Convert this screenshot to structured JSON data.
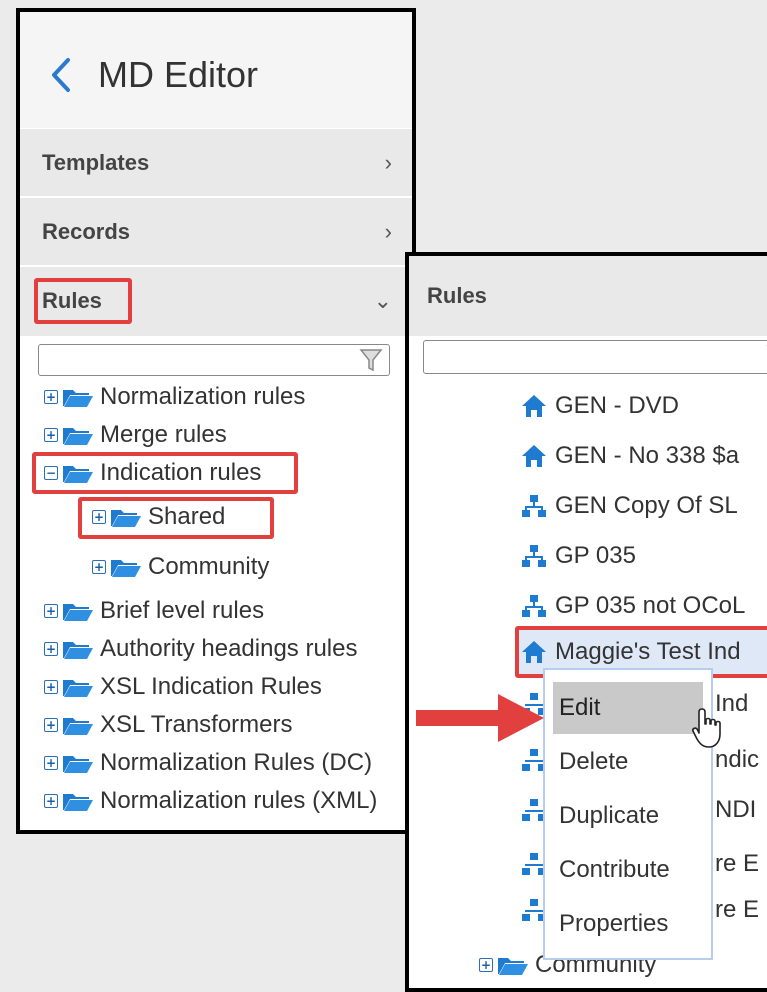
{
  "panel1": {
    "title": "MD Editor",
    "sections": [
      {
        "label": "Templates",
        "chevron": "›"
      },
      {
        "label": "Records",
        "chevron": "›"
      },
      {
        "label": "Rules",
        "chevron": "⌄"
      }
    ],
    "filter_icon": "funnel-icon",
    "tree": [
      {
        "label": "Normalization rules",
        "toggle": "+"
      },
      {
        "label": "Merge rules",
        "toggle": "+"
      },
      {
        "label": "Indication rules",
        "toggle": "−"
      },
      {
        "label": "Shared",
        "toggle": "+"
      },
      {
        "label": "Community",
        "toggle": "+"
      },
      {
        "label": "Brief level rules",
        "toggle": "+"
      },
      {
        "label": "Authority headings rules",
        "toggle": "+"
      },
      {
        "label": "XSL Indication Rules",
        "toggle": "+"
      },
      {
        "label": "XSL Transformers",
        "toggle": "+"
      },
      {
        "label": "Normalization Rules (DC)",
        "toggle": "+"
      },
      {
        "label": "Normalization rules (XML)",
        "toggle": "+"
      }
    ]
  },
  "panel2": {
    "title": "Rules",
    "rules": [
      {
        "label": "GEN - DVD",
        "icon": "home-icon"
      },
      {
        "label": "GEN - No 338 $a",
        "icon": "home-icon"
      },
      {
        "label": "GEN Copy Of SL",
        "icon": "network-icon"
      },
      {
        "label": "GP 035",
        "icon": "network-icon"
      },
      {
        "label": "GP 035 not OCoL",
        "icon": "network-icon"
      },
      {
        "label": "Maggie's Test Ind",
        "icon": "home-icon"
      }
    ],
    "hidden_fragments": [
      "Ind",
      "ndic",
      "NDI",
      "re E",
      "re E"
    ],
    "community_label": "Community",
    "context_menu": [
      "Edit",
      "Delete",
      "Duplicate",
      "Contribute",
      "Properties"
    ]
  },
  "colors": {
    "highlight": "#e2403f",
    "icon_blue": "#1f7bd0",
    "selection": "#dfe8f7",
    "menu_hover": "#c9c9c9"
  }
}
